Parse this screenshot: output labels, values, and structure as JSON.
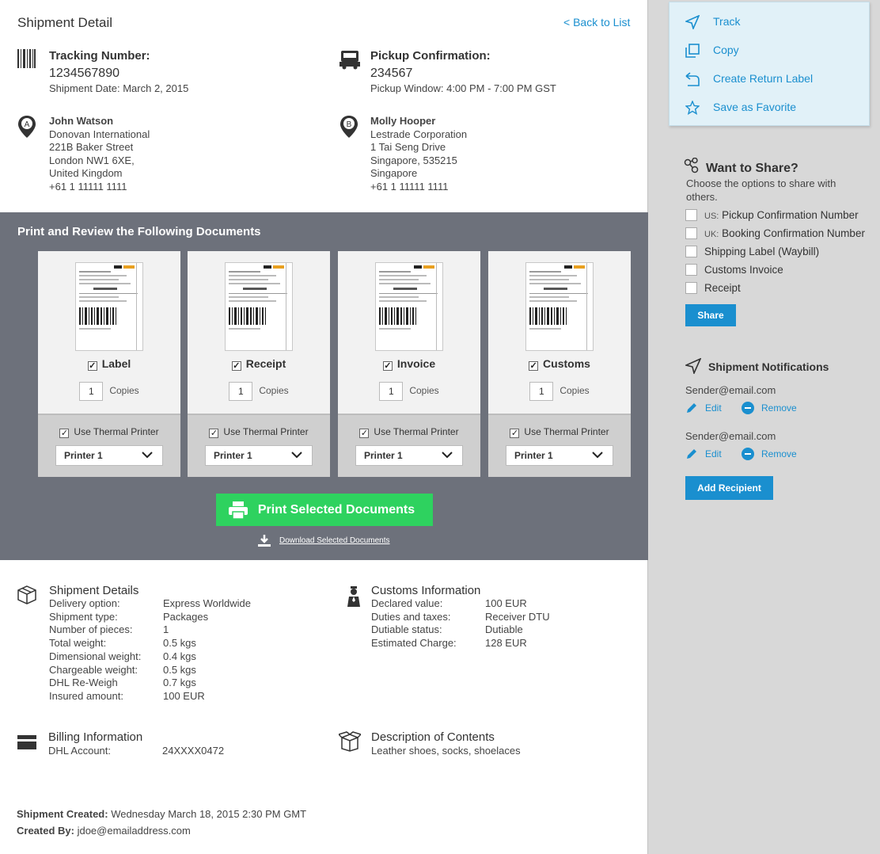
{
  "header": {
    "title": "Shipment Detail",
    "back_link": "< Back to List"
  },
  "tracking": {
    "label": "Tracking Number:",
    "number": "1234567890",
    "date": "Shipment Date: March 2, 2015"
  },
  "pickup": {
    "label": "Pickup Confirmation:",
    "number": "234567",
    "window": "Pickup Window: 4:00 PM - 7:00 PM GST"
  },
  "sender": {
    "marker": "A",
    "name": "John Watson",
    "lines": [
      "Donovan International",
      "221B Baker Street",
      "London NW1 6XE,",
      "United Kingdom",
      "+61 1 11111 1111"
    ]
  },
  "receiver": {
    "marker": "B",
    "name": "Molly Hooper",
    "lines": [
      "Lestrade Corporation",
      "1 Tai Seng Drive",
      "Singapore, 535215",
      "Singapore",
      "+61 1 11111 1111"
    ]
  },
  "documents": {
    "title": "Print and Review the Following Documents",
    "copies_label": "Copies",
    "thermal_label": "Use Thermal Printer",
    "cards": [
      {
        "name": "Label",
        "copies": "1",
        "printer": "Printer 1"
      },
      {
        "name": "Receipt",
        "copies": "1",
        "printer": "Printer 1"
      },
      {
        "name": "Invoice",
        "copies": "1",
        "printer": "Printer 1"
      },
      {
        "name": "Customs",
        "copies": "1",
        "printer": "Printer 1"
      }
    ],
    "print_button": "Print Selected Documents",
    "download_link": "Download Selected Documents"
  },
  "shipment_details": {
    "title": "Shipment Details",
    "rows": [
      {
        "k": "Delivery option:",
        "v": "Express Worldwide"
      },
      {
        "k": "Shipment type:",
        "v": "Packages"
      },
      {
        "k": "Number of pieces:",
        "v": "1"
      },
      {
        "k": "Total weight:",
        "v": "0.5 kgs"
      },
      {
        "k": "Dimensional weight:",
        "v": "0.4 kgs"
      },
      {
        "k": "Chargeable weight:",
        "v": "0.5 kgs"
      },
      {
        "k": "DHL Re-Weigh",
        "v": "0.7 kgs"
      },
      {
        "k": "Insured amount:",
        "v": "100 EUR"
      }
    ]
  },
  "customs_info": {
    "title": "Customs Information",
    "rows": [
      {
        "k": "Declared value:",
        "v": "100 EUR"
      },
      {
        "k": "Duties and taxes:",
        "v": "Receiver DTU"
      },
      {
        "k": "Dutiable status:",
        "v": "Dutiable"
      },
      {
        "k": "Estimated Charge:",
        "v": "128 EUR"
      }
    ]
  },
  "billing": {
    "title": "Billing Information",
    "k": "DHL Account:",
    "v": "24XXXX0472"
  },
  "contents": {
    "title": "Description of Contents",
    "text": "Leather shoes, socks, shoelaces"
  },
  "footer": {
    "created_label": "Shipment Created:",
    "created_value": " Wednesday March 18, 2015 2:30 PM GMT",
    "by_label": "Created By:",
    "by_value": " jdoe@emailaddress.com"
  },
  "menu": {
    "items": [
      "Track",
      "Copy",
      "Create Return Label",
      "Save as Favorite"
    ]
  },
  "share": {
    "title": "Want to Share?",
    "desc1": "Choose the options to share with",
    "desc2": "others.",
    "options": [
      {
        "prefix": "US:",
        "label": "Pickup Confirmation Number"
      },
      {
        "prefix": "UK:",
        "label": "Booking Confirmation Number"
      },
      {
        "prefix": "",
        "label": "Shipping Label (Waybill)"
      },
      {
        "prefix": "",
        "label": "Customs Invoice"
      },
      {
        "prefix": "",
        "label": "Receipt"
      }
    ],
    "button": "Share"
  },
  "notifications": {
    "title": "Shipment Notifications",
    "recipients": [
      {
        "email": "Sender@email.com",
        "edit": "Edit",
        "remove": "Remove"
      },
      {
        "email": "Sender@email.com",
        "edit": "Edit",
        "remove": "Remove"
      }
    ],
    "add_button": "Add Recipient"
  },
  "colors": {
    "accent": "#1a8fcf",
    "print_green": "#2ed25f",
    "docs_bg": "#6d717b"
  }
}
